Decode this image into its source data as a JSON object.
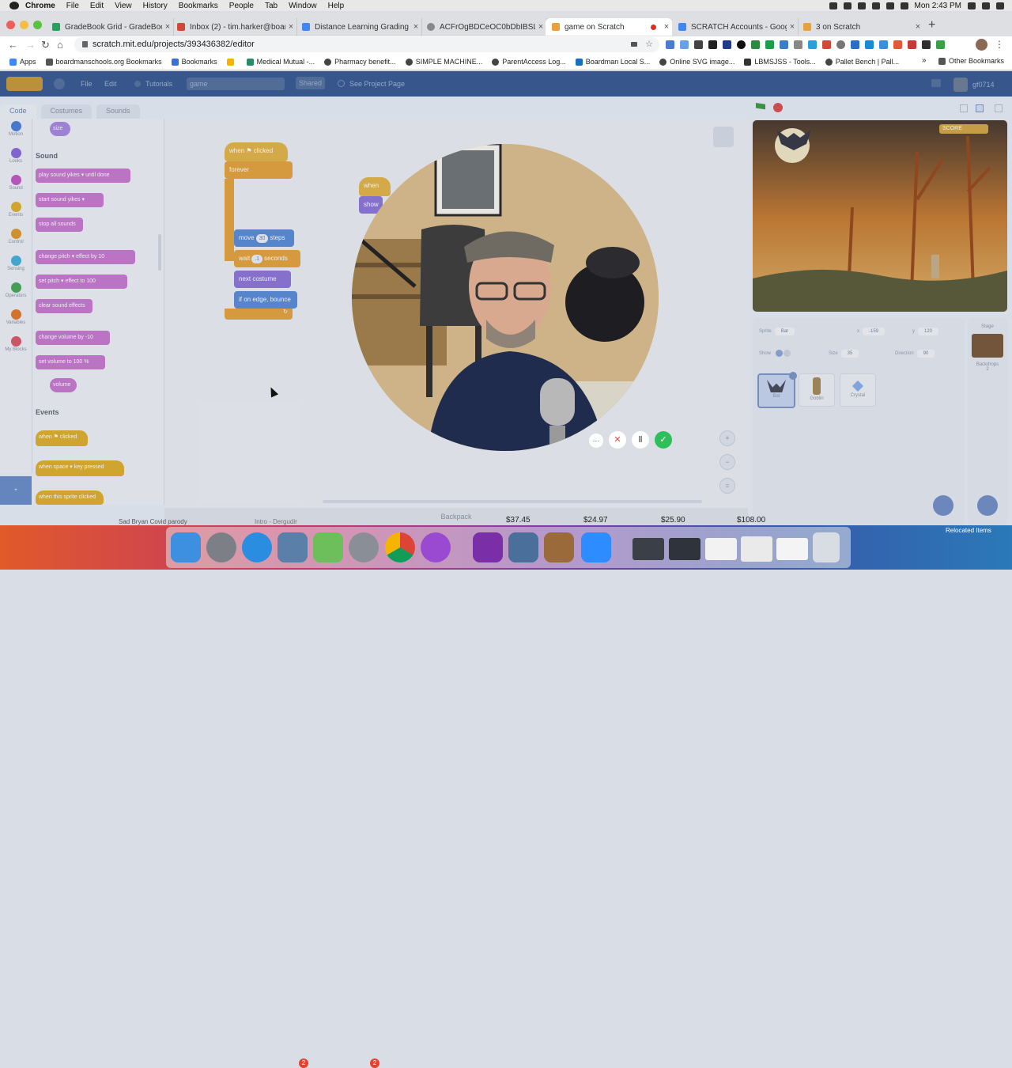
{
  "mac_menubar": {
    "app": "Chrome",
    "items": [
      "File",
      "Edit",
      "View",
      "History",
      "Bookmarks",
      "People",
      "Tab",
      "Window",
      "Help"
    ],
    "clock": "Mon 2:43 PM"
  },
  "browser": {
    "tabs": [
      {
        "title": "GradeBook Grid - GradeBook",
        "favicon": "gradebook-icon",
        "color": "#2e9e5e"
      },
      {
        "title": "Inbox (2) - tim.harker@boardm",
        "favicon": "gmail-icon",
        "color": "#d44638"
      },
      {
        "title": "Distance Learning Grading No",
        "favicon": "docs-icon",
        "color": "#4285f4"
      },
      {
        "title": "ACFrOgBDCeOC0bDbIBSLZ7u",
        "favicon": "globe-icon",
        "color": "#888888"
      },
      {
        "title": "game on Scratch",
        "favicon": "scratch-icon",
        "color": "#e9a23b"
      },
      {
        "title": "SCRATCH Accounts - Google D",
        "favicon": "docs-icon",
        "color": "#4285f4"
      },
      {
        "title": "3 on Scratch",
        "favicon": "scratch-icon",
        "color": "#e9a23b"
      }
    ],
    "active_tab": 4,
    "new_tab": "+",
    "url": "scratch.mit.edu/projects/393436382/editor",
    "bookmarks": [
      {
        "label": "Apps",
        "icon": "apps-icon"
      },
      {
        "label": "boardmanschools.org Bookmarks",
        "icon": "folder-icon"
      },
      {
        "label": "Bookmarks",
        "icon": "star-icon"
      },
      {
        "label": "",
        "icon": "drive-icon"
      },
      {
        "label": "Medical Mutual -...",
        "icon": "medical-icon"
      },
      {
        "label": "Pharmacy benefit...",
        "icon": "globe-icon"
      },
      {
        "label": "SIMPLE MACHINE...",
        "icon": "globe-icon"
      },
      {
        "label": "ParentAccess Log...",
        "icon": "globe-icon"
      },
      {
        "label": "Boardman Local S...",
        "icon": "school-icon"
      },
      {
        "label": "Online SVG image...",
        "icon": "globe-icon"
      },
      {
        "label": "LBMSJSS - Tools...",
        "icon": "tools-icon"
      },
      {
        "label": "Pallet Bench | Pall...",
        "icon": "globe-icon"
      }
    ],
    "other_bookmarks": "Other Bookmarks"
  },
  "scratch": {
    "menu": {
      "file": "File",
      "edit": "Edit",
      "tutorials": "Tutorials",
      "title": "game",
      "shared": "Shared",
      "see_project": "See Project Page",
      "user": "gf0714"
    },
    "tabs": [
      "Code",
      "Costumes",
      "Sounds"
    ],
    "categories": [
      {
        "label": "Motion",
        "color": "#4c7fd8"
      },
      {
        "label": "Looks",
        "color": "#8a6ad8"
      },
      {
        "label": "Sound",
        "color": "#c05ac4"
      },
      {
        "label": "Events",
        "color": "#e0b02e"
      },
      {
        "label": "Control",
        "color": "#e09a2e"
      },
      {
        "label": "Sensing",
        "color": "#4ab0d8"
      },
      {
        "label": "Operators",
        "color": "#4aa85a"
      },
      {
        "label": "Variables",
        "color": "#e07a2e"
      },
      {
        "label": "My Blocks",
        "color": "#d85a6a"
      }
    ],
    "palette": {
      "size_reporter": "size",
      "sound_head": "Sound",
      "sound_blocks": [
        "play sound  yikes ▾  until done",
        "start sound  yikes ▾",
        "stop all sounds",
        "change  pitch ▾  effect by  10",
        "set  pitch ▾  effect to  100",
        "clear sound effects",
        "change volume by  -10",
        "set volume to  100  %",
        "volume"
      ],
      "events_head": "Events",
      "events_blocks": [
        "when  ⚑  clicked",
        "when  space ▾  key pressed",
        "when this sprite clicked"
      ]
    },
    "script": {
      "hat": "when  ⚑  clicked",
      "forever": "forever",
      "move_a": "move",
      "move_val": "30",
      "move_b": "steps",
      "wait_a": "wait",
      "wait_val": ".1",
      "wait_b": "seconds",
      "next": "next costume",
      "bounce": "if on edge, bounce"
    },
    "script2": [
      "when",
      "show"
    ],
    "zoom": [
      "+",
      "−",
      "="
    ],
    "backpack": "Backpack",
    "stage": {
      "score_label": "SCORE"
    },
    "sprite_info": {
      "sprite_label": "Sprite",
      "sprite_name": "Bat",
      "x_label": "x",
      "x_val": "-159",
      "y_label": "y",
      "y_val": "120",
      "show_label": "Show",
      "size_label": "Size",
      "size_val": "35",
      "direction_label": "Direction",
      "direction_val": "90"
    },
    "sprites": [
      "Bat",
      "Goblin",
      "Crystal"
    ],
    "stage_pane": {
      "label": "Stage",
      "backdrops_label": "Backdrops",
      "backdrops_count": "2"
    }
  },
  "video_overlay": {
    "controls": [
      "more-icon",
      "close-icon",
      "pause-icon",
      "check-icon"
    ]
  },
  "background_sheet": {
    "cells": [
      "Sad Bryan Covid parody",
      "Intro - Dergudir",
      "$37.45",
      "$24.97",
      "$25.90",
      "$108.00"
    ]
  },
  "dock": {
    "apps": [
      {
        "name": "finder-icon",
        "color": "#3d8fe0"
      },
      {
        "name": "launchpad-icon",
        "color": "#7c7f86"
      },
      {
        "name": "safari-icon",
        "color": "#2a8de0"
      },
      {
        "name": "preview-icon",
        "color": "#5a7fa8",
        "badge": "2"
      },
      {
        "name": "maps-icon",
        "color": "#6cbf5a"
      },
      {
        "name": "system-preferences-icon",
        "color": "#8a8e96",
        "badge": "2"
      },
      {
        "name": "chrome-icon",
        "color": "#e0b02e"
      },
      {
        "name": "podcasts-icon",
        "color": "#9a4ad0"
      },
      {
        "name": "onenote-icon",
        "color": "#7a2fa8"
      },
      {
        "name": "photo-icon",
        "color": "#4a6f9a"
      },
      {
        "name": "guitar-icon",
        "color": "#9a6a3a"
      },
      {
        "name": "zoom-icon",
        "color": "#2d8cff"
      },
      {
        "name": "window-thumb-1-icon",
        "color": "#3a3f48"
      },
      {
        "name": "window-thumb-2-icon",
        "color": "#2f343c"
      },
      {
        "name": "window-thumb-3-icon",
        "color": "#f2f2f2"
      },
      {
        "name": "window-thumb-4-icon",
        "color": "#eaeaea"
      },
      {
        "name": "window-thumb-5-icon",
        "color": "#f4f4f4"
      },
      {
        "name": "trash-icon",
        "color": "#d8dde3"
      }
    ],
    "relocated": "Relocated Items"
  }
}
